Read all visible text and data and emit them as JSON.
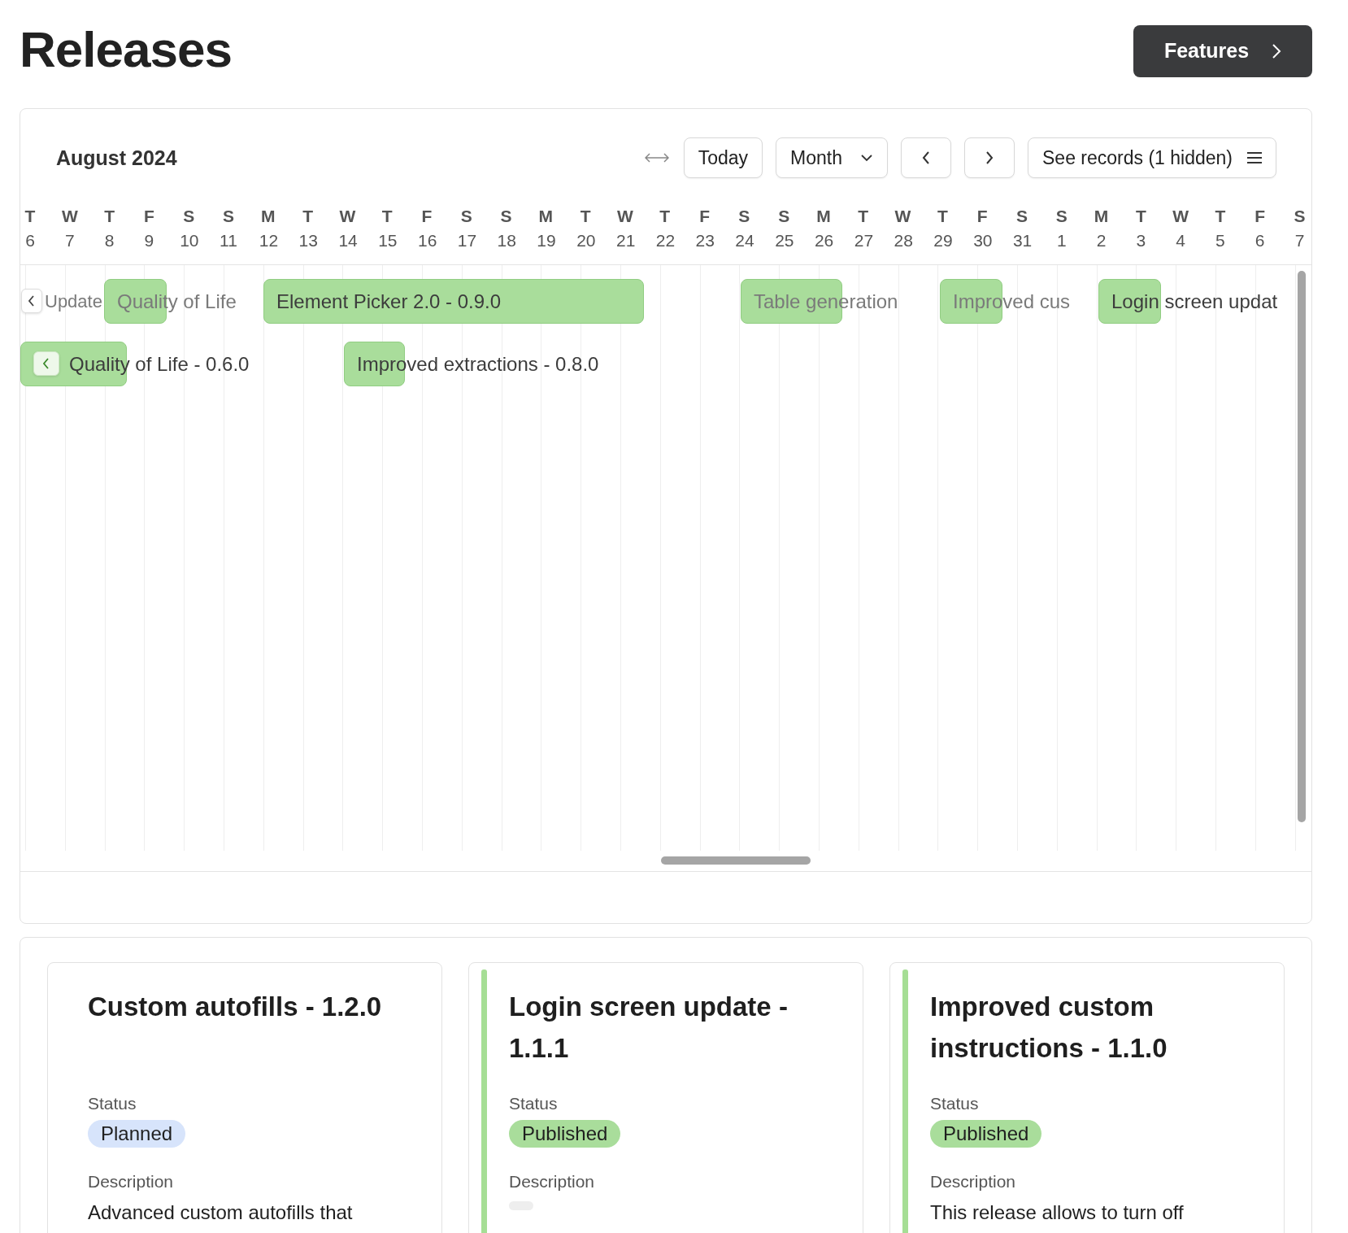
{
  "page": {
    "title": "Releases",
    "features_button": "Features"
  },
  "calendar": {
    "month": "August 2024",
    "today_button": "Today",
    "view_select": "Month",
    "records_button": "See records (1 hidden)",
    "days": [
      {
        "weekday": "T",
        "date": "6"
      },
      {
        "weekday": "W",
        "date": "7"
      },
      {
        "weekday": "T",
        "date": "8"
      },
      {
        "weekday": "F",
        "date": "9"
      },
      {
        "weekday": "S",
        "date": "10"
      },
      {
        "weekday": "S",
        "date": "11"
      },
      {
        "weekday": "M",
        "date": "12"
      },
      {
        "weekday": "T",
        "date": "13"
      },
      {
        "weekday": "W",
        "date": "14"
      },
      {
        "weekday": "T",
        "date": "15"
      },
      {
        "weekday": "F",
        "date": "16"
      },
      {
        "weekday": "S",
        "date": "17"
      },
      {
        "weekday": "S",
        "date": "18"
      },
      {
        "weekday": "M",
        "date": "19"
      },
      {
        "weekday": "T",
        "date": "20"
      },
      {
        "weekday": "W",
        "date": "21"
      },
      {
        "weekday": "T",
        "date": "22"
      },
      {
        "weekday": "F",
        "date": "23"
      },
      {
        "weekday": "S",
        "date": "24"
      },
      {
        "weekday": "S",
        "date": "25"
      },
      {
        "weekday": "M",
        "date": "26"
      },
      {
        "weekday": "T",
        "date": "27"
      },
      {
        "weekday": "W",
        "date": "28"
      },
      {
        "weekday": "T",
        "date": "29"
      },
      {
        "weekday": "F",
        "date": "30"
      },
      {
        "weekday": "S",
        "date": "31"
      },
      {
        "weekday": "S",
        "date": "1"
      },
      {
        "weekday": "M",
        "date": "2"
      },
      {
        "weekday": "T",
        "date": "3"
      },
      {
        "weekday": "W",
        "date": "4"
      },
      {
        "weekday": "T",
        "date": "5"
      },
      {
        "weekday": "F",
        "date": "6"
      },
      {
        "weekday": "S",
        "date": "7"
      }
    ],
    "events": [
      {
        "label": "Update",
        "faded": true,
        "continues_left": true
      },
      {
        "label": "Quality of Life",
        "faded": true,
        "continues_left": false
      },
      {
        "label": "Element Picker 2.0 - 0.9.0",
        "faded": false,
        "continues_left": false
      },
      {
        "label": "Table generation",
        "faded": true,
        "continues_left": false
      },
      {
        "label": "Improved cus",
        "faded": true,
        "continues_left": false
      },
      {
        "label": "Login screen updat",
        "faded": false,
        "continues_left": false
      },
      {
        "label": "Quality of Life - 0.6.0",
        "faded": false,
        "continues_left": true
      },
      {
        "label": "Improved extractions - 0.8.0",
        "faded": false,
        "continues_left": false
      }
    ]
  },
  "releases": [
    {
      "title": "Custom autofills - 1.2.0",
      "status_label": "Status",
      "status": "Planned",
      "published": false,
      "description_label": "Description",
      "description": "Advanced custom autofills that"
    },
    {
      "title": "Login screen update - 1.1.1",
      "status_label": "Status",
      "status": "Published",
      "published": true,
      "description_label": "Description"
    },
    {
      "title": "Improved custom instructions - 1.1.0",
      "status_label": "Status",
      "status": "Published",
      "published": true,
      "description_label": "Description",
      "description": "This release allows to turn off"
    }
  ]
}
